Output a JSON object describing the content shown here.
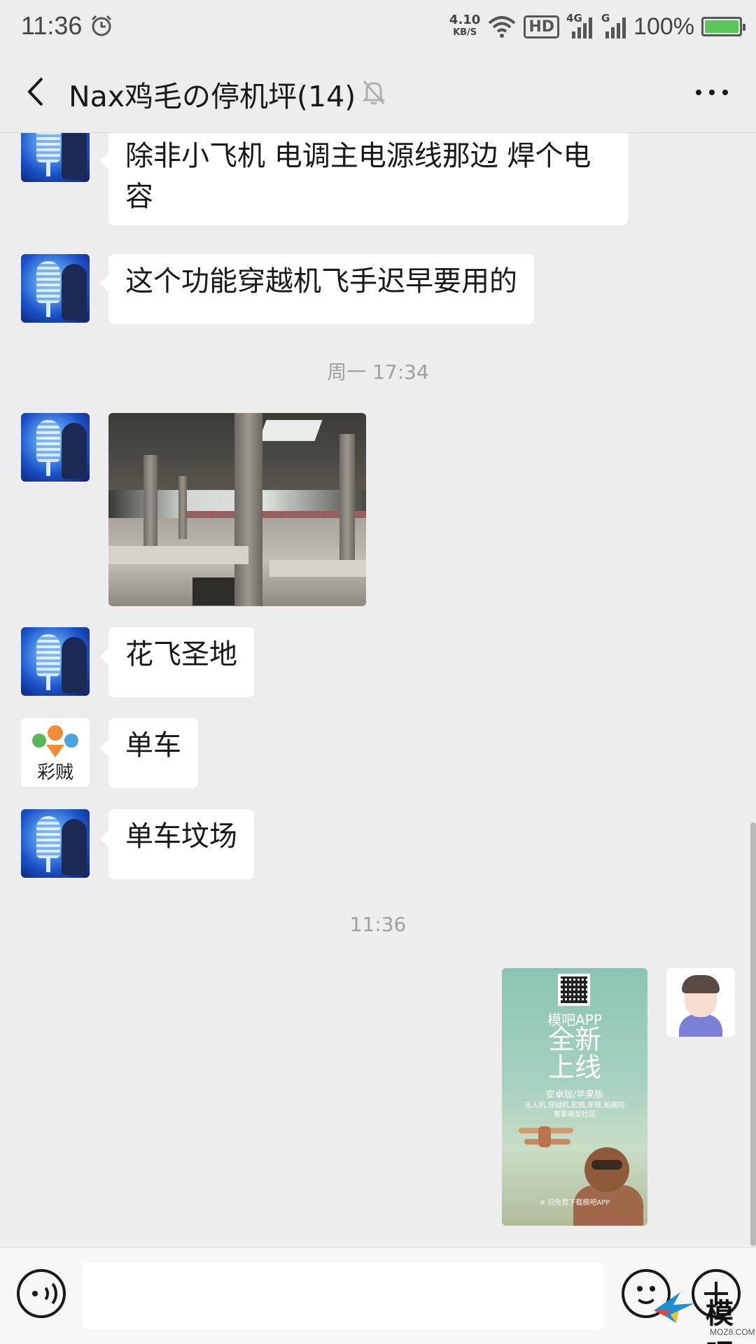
{
  "status_bar": {
    "time": "11:36",
    "net_speed_value": "4.10",
    "net_speed_unit": "KB/S",
    "hd_label": "HD",
    "signal1_tag": "4G",
    "signal2_tag": "G",
    "battery_percent": "100%",
    "battery_level": 1.0,
    "icons": [
      "alarm-icon",
      "wifi-icon",
      "signal-icon",
      "battery-icon"
    ]
  },
  "header": {
    "title": "Nax鸡毛の停机坪(14)",
    "icons": [
      "back-icon",
      "mute-icon",
      "more-icon"
    ]
  },
  "messages": [
    {
      "type": "text",
      "side": "left",
      "avatar": "blue",
      "text_line1": "除非小飞机 电调主电源线那边 焊个电",
      "text_line2": "容"
    },
    {
      "type": "text",
      "side": "left",
      "avatar": "blue",
      "text": "这个功能穿越机飞手迟早要用的"
    },
    {
      "type": "timestamp",
      "text": "周一 17:34"
    },
    {
      "type": "image",
      "side": "left",
      "avatar": "blue",
      "description": "photo"
    },
    {
      "type": "text",
      "side": "left",
      "avatar": "blue",
      "text": "花飞圣地"
    },
    {
      "type": "text",
      "side": "left",
      "avatar": "cai",
      "avatar_text": "彩贼",
      "text": "单车"
    },
    {
      "type": "text",
      "side": "left",
      "avatar": "blue",
      "text": "单车坟场"
    },
    {
      "type": "timestamp",
      "text": "11:36"
    },
    {
      "type": "image",
      "side": "right",
      "avatar": "me",
      "poster": {
        "app_label": "模吧APP",
        "headline_line1": "全新",
        "headline_line2": "上线",
        "platforms": "安卓版/苹果版",
        "desc_line1": "无人机,穿越机,航模,车模,船模的",
        "desc_line2": "智能模型社区",
        "footer": "# 扫免费下载模吧APP"
      }
    }
  ],
  "input_bar": {
    "placeholder": "",
    "icons": [
      "voice-icon",
      "emoji-icon",
      "plus-icon"
    ]
  },
  "watermark": {
    "text": "模吧",
    "sub": "MOZ8.COM"
  }
}
